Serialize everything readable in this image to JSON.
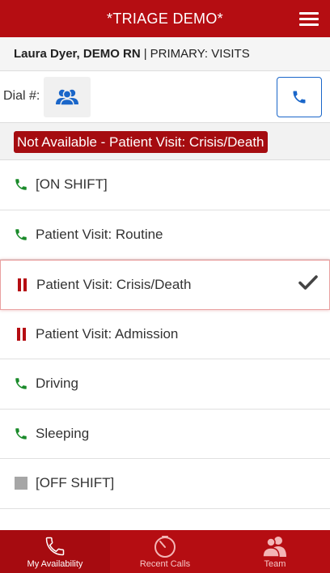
{
  "header": {
    "title": "*TRIAGE DEMO*"
  },
  "user": {
    "name": "Laura Dyer, DEMO RN",
    "separator": "|",
    "role": "PRIMARY: VISITS"
  },
  "dial": {
    "label": "Dial #:"
  },
  "status": {
    "badge": "Not Available - Patient Visit: Crisis/Death"
  },
  "availability": [
    {
      "label": "[ON SHIFT]",
      "icon": "phone-icon",
      "color": "#1a8a2a"
    },
    {
      "label": "Patient Visit: Routine",
      "icon": "phone-icon",
      "color": "#1a8a2a"
    },
    {
      "label": "Patient Visit: Crisis/Death",
      "icon": "pause-icon",
      "color": "#b50d12",
      "selected": true
    },
    {
      "label": "Patient Visit: Admission",
      "icon": "pause-icon",
      "color": "#b50d12"
    },
    {
      "label": "Driving",
      "icon": "phone-icon",
      "color": "#1a8a2a"
    },
    {
      "label": "Sleeping",
      "icon": "phone-icon",
      "color": "#1a8a2a"
    },
    {
      "label": "[OFF SHIFT]",
      "icon": "stop-icon",
      "color": "#a6a6a6"
    }
  ],
  "tabs": [
    {
      "label": "My Availability",
      "icon": "phone-outline-icon",
      "active": true
    },
    {
      "label": "Recent Calls",
      "icon": "timer-icon"
    },
    {
      "label": "Team",
      "icon": "team-icon"
    }
  ],
  "colors": {
    "brand": "#b50d12",
    "call_blue": "#1a66c9",
    "available_green": "#1a8a2a"
  }
}
